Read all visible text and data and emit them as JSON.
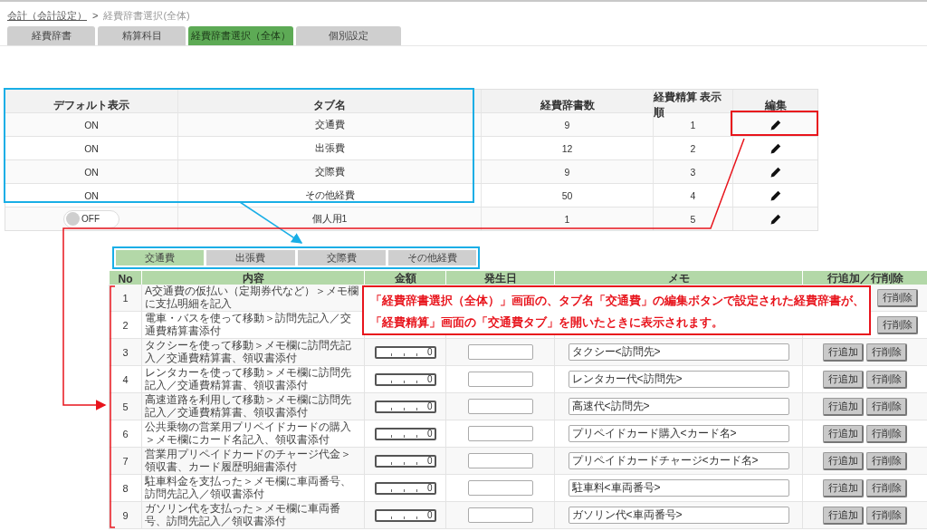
{
  "breadcrumb": {
    "link": "会計（会計設定）",
    "separator": ">",
    "current": "経費辞書選択(全体)"
  },
  "tabs": [
    {
      "label": "経費辞書",
      "selected": false
    },
    {
      "label": "精算科目",
      "selected": false
    },
    {
      "label": "経費辞書選択（全体）",
      "selected": true
    },
    {
      "label": "個別設定",
      "selected": false
    }
  ],
  "dictionary_table": {
    "columns": [
      "デフォルト表示",
      "タブ名",
      "経費辞書数",
      "経費精算 表示順",
      "編集"
    ],
    "rows": [
      {
        "default_display": {
          "on": true,
          "label": "ON"
        },
        "tab_name": "交通費",
        "count": "9",
        "order": "1"
      },
      {
        "default_display": {
          "on": true,
          "label": "ON"
        },
        "tab_name": "出張費",
        "count": "12",
        "order": "2"
      },
      {
        "default_display": {
          "on": true,
          "label": "ON"
        },
        "tab_name": "交際費",
        "count": "9",
        "order": "3"
      },
      {
        "default_display": {
          "on": true,
          "label": "ON"
        },
        "tab_name": "その他経費",
        "count": "50",
        "order": "4"
      },
      {
        "default_display": {
          "on": false,
          "label": "OFF"
        },
        "tab_name": "個人用1",
        "count": "1",
        "order": "5"
      }
    ]
  },
  "settlement_screen": {
    "tabs": [
      {
        "label": "交通費",
        "selected": true
      },
      {
        "label": "出張費",
        "selected": false
      },
      {
        "label": "交際費",
        "selected": false
      },
      {
        "label": "その他経費",
        "selected": false
      }
    ],
    "columns": [
      "No",
      "内容",
      "金額",
      "発生日",
      "メモ",
      "行追加／行削除"
    ],
    "rows": [
      {
        "no": "1",
        "description": "A交通費の仮払い（定期券代など）＞メモ欄に支払明細を記入",
        "delete_button": "行削除"
      },
      {
        "no": "2",
        "description": "電車・バスを使って移動＞訪問先記入／交通費精算書添付",
        "delete_button": "行削除"
      },
      {
        "no": "3",
        "description": "タクシーを使って移動＞メモ欄に訪問先記入／交通費精算書、領収書添付",
        "amount": "0",
        "memo": "タクシー<訪問先>",
        "add_button": "行追加",
        "delete_button": "行削除"
      },
      {
        "no": "4",
        "description": "レンタカーを使って移動＞メモ欄に訪問先記入／交通費精算書、領収書添付",
        "amount": "0",
        "memo": "レンタカー代<訪問先>",
        "add_button": "行追加",
        "delete_button": "行削除"
      },
      {
        "no": "5",
        "description": "高速道路を利用して移動＞メモ欄に訪問先記入／交通費精算書、領収書添付",
        "amount": "0",
        "memo": "高速代<訪問先>",
        "add_button": "行追加",
        "delete_button": "行削除"
      },
      {
        "no": "6",
        "description": "公共乗物の営業用プリペイドカードの購入＞メモ欄にカード名記入、領収書添付",
        "amount": "0",
        "memo": "プリペイドカード購入<カード名>",
        "add_button": "行追加",
        "delete_button": "行削除"
      },
      {
        "no": "7",
        "description": "営業用プリペイドカードのチャージ代金＞領収書、カード履歴明細書添付",
        "amount": "0",
        "memo": "プリペイドカードチャージ<カード名>",
        "add_button": "行追加",
        "delete_button": "行削除"
      },
      {
        "no": "8",
        "description": "駐車料金を支払った＞メモ欄に車両番号、訪問先記入／領収書添付",
        "amount": "0",
        "memo": "駐車料<車両番号>",
        "add_button": "行追加",
        "delete_button": "行削除"
      },
      {
        "no": "9",
        "description": "ガソリン代を支払った＞メモ欄に車両番号、訪問先記入／領収書添付",
        "amount": "0",
        "memo": "ガソリン代<車両番号>",
        "add_button": "行追加",
        "delete_button": "行削除"
      }
    ]
  },
  "annotation": {
    "lines": [
      "「経費辞書選択（全体）」画面の、タブ名「交通費」の編集ボタンで設定された経費辞書が、",
      "「経費精算」画面の「交通費タブ」を開いたときに表示されます。"
    ]
  }
}
